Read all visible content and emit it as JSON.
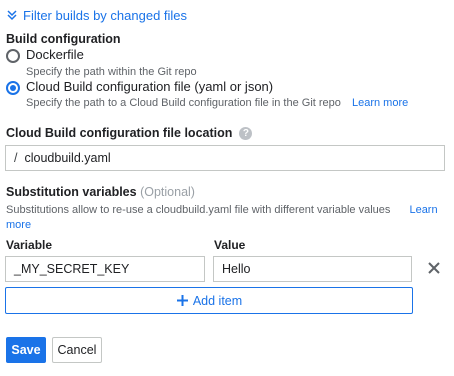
{
  "filter_link": {
    "label": "Filter builds by changed files"
  },
  "build_config": {
    "title": "Build configuration",
    "options": [
      {
        "label": "Dockerfile",
        "help": "Specify the path within the Git repo",
        "selected": false
      },
      {
        "label": "Cloud Build configuration file (yaml or json)",
        "help": "Specify the path to a Cloud Build configuration file in the Git repo",
        "learn_more": "Learn more",
        "selected": true
      }
    ]
  },
  "config_location": {
    "title": "Cloud Build configuration file location",
    "help_icon": "question-circle-icon",
    "prefix": "/",
    "value": "cloudbuild.yaml"
  },
  "substitution": {
    "title": "Substitution variables",
    "optional": "(Optional)",
    "help": "Substitutions allow to re-use a cloudbuild.yaml file with different variable values",
    "learn_more_line1": "Learn",
    "learn_more_line2": "more",
    "variable_label": "Variable",
    "value_label": "Value",
    "rows": [
      {
        "variable": "_MY_SECRET_KEY",
        "value": "Hello"
      }
    ],
    "add_item": "Add item",
    "remove_icon": "close-icon"
  },
  "actions": {
    "save": "Save",
    "cancel": "Cancel"
  },
  "colors": {
    "accent": "#1a73e8",
    "text": "#202124",
    "muted": "#5f6368"
  }
}
